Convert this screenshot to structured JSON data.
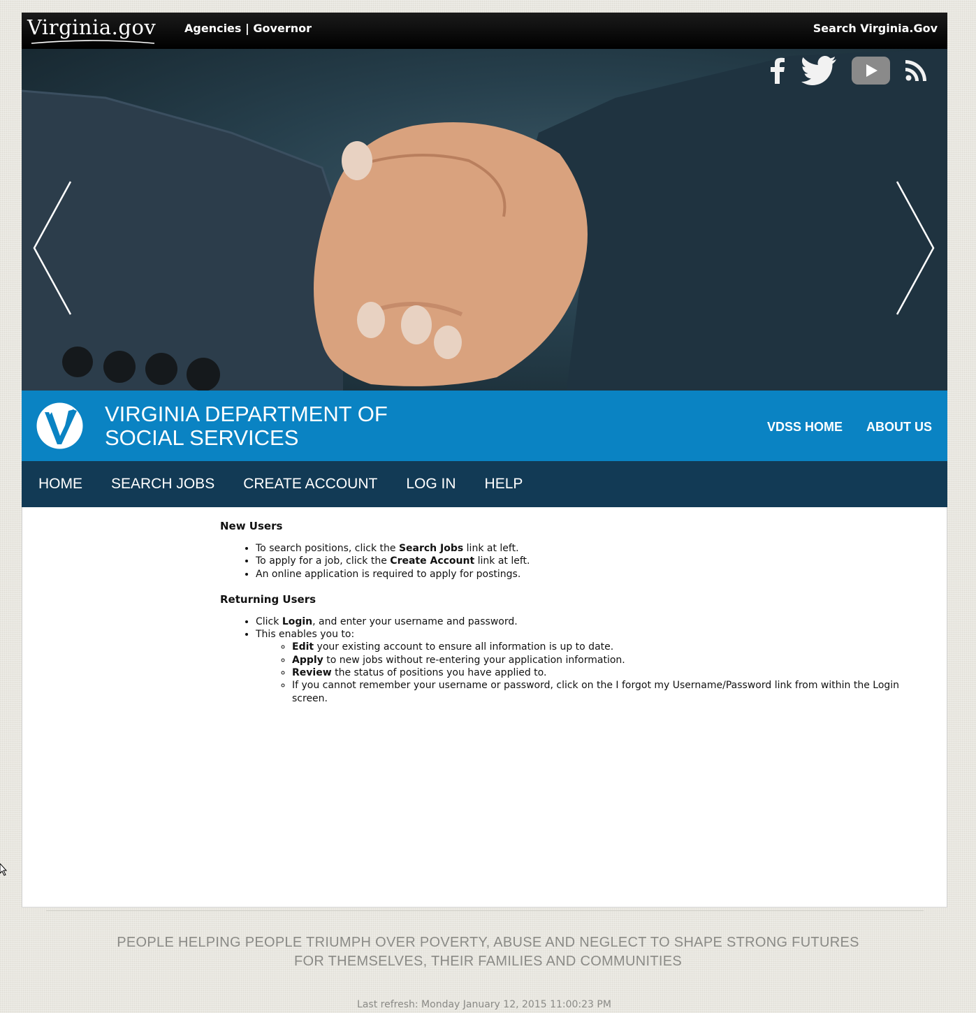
{
  "topbar": {
    "logo_main": "Virginia",
    "logo_suffix": ".gov",
    "link_agencies": "Agencies",
    "separator": "|",
    "link_governor": "Governor",
    "search_label": "Search Virginia.Gov"
  },
  "social": [
    "facebook-icon",
    "twitter-icon",
    "youtube-icon",
    "rss-icon"
  ],
  "brand": {
    "title_line1": "VIRGINIA DEPARTMENT OF",
    "title_line2": "SOCIAL SERVICES",
    "link_home": "VDSS HOME",
    "link_about": "ABOUT US",
    "color": "#0a83c3"
  },
  "nav": {
    "home": "HOME",
    "search_jobs": "SEARCH JOBS",
    "create_account": "CREATE ACCOUNT",
    "log_in": "LOG IN",
    "help": "HELP",
    "color": "#123a55"
  },
  "content": {
    "new_users_heading": "New Users",
    "new_users": [
      {
        "pre": "To search positions, click the ",
        "bold": "Search Jobs",
        "post": " link at left."
      },
      {
        "pre": "To apply for a job, click the ",
        "bold": "Create Account",
        "post": " link at left."
      },
      {
        "pre": "An online application is required to apply for postings.",
        "bold": "",
        "post": ""
      }
    ],
    "returning_heading": "Returning Users",
    "returning": [
      {
        "pre": "Click ",
        "bold": "Login",
        "post": ", and enter your username and password."
      },
      {
        "pre": "This enables you to:",
        "bold": "",
        "post": ""
      }
    ],
    "enables": [
      {
        "bold": "Edit",
        "post": " your existing account to ensure all information is up to date."
      },
      {
        "bold": "Apply",
        "post": " to new jobs without re-entering your application information."
      },
      {
        "bold": "Review",
        "post": " the status of positions you have applied to."
      },
      {
        "bold": "",
        "post": "If you cannot remember your username or password, click on the I forgot my Username/Password link from within the Login screen."
      }
    ]
  },
  "footer": {
    "tagline_line1": "PEOPLE HELPING PEOPLE TRIUMPH OVER POVERTY, ABUSE AND NEGLECT TO SHAPE STRONG FUTURES",
    "tagline_line2": "FOR THEMSELVES, THEIR FAMILIES AND COMMUNITIES",
    "last_refresh": "Last refresh: Monday January 12, 2015 11:00:23 PM"
  }
}
